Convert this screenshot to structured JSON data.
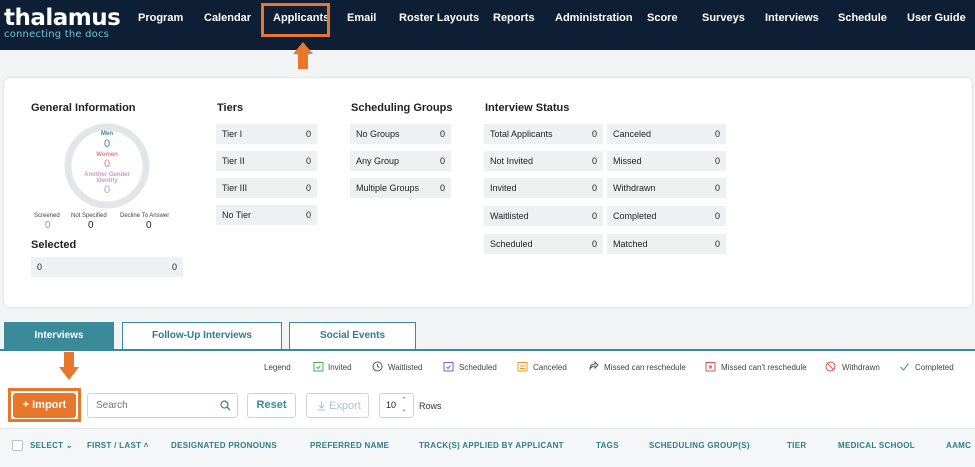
{
  "brand": {
    "name": "thalamus",
    "tagline": "connecting the docs"
  },
  "nav": {
    "items": [
      "Program",
      "Calendar",
      "Applicants",
      "Email",
      "Roster Layouts",
      "Reports",
      "Administration",
      "Score",
      "Surveys",
      "Interviews",
      "Schedule",
      "User Guide"
    ],
    "active": "Applicants"
  },
  "general_info": {
    "title": "General Information",
    "men_label": "Men",
    "men_value": "0",
    "women_label": "Women",
    "women_value": "0",
    "another_label_1": "Another Gender",
    "another_label_2": "Identity",
    "another_value": "0",
    "screened_label": "Screened",
    "screened_value": "0",
    "not_specified_label": "Not Specified",
    "not_specified_value": "0",
    "decline_label": "Decline To Answer",
    "decline_value": "0",
    "selected_title": "Selected",
    "selected_left": "0",
    "selected_right": "0"
  },
  "tiers": {
    "title": "Tiers",
    "rows": [
      {
        "label": "Tier I",
        "value": "0"
      },
      {
        "label": "Tier II",
        "value": "0"
      },
      {
        "label": "Tier III",
        "value": "0"
      },
      {
        "label": "No Tier",
        "value": "0"
      }
    ]
  },
  "scheduling_groups": {
    "title": "Scheduling Groups",
    "rows": [
      {
        "label": "No Groups",
        "value": "0"
      },
      {
        "label": "Any Group",
        "value": "0"
      },
      {
        "label": "Multiple Groups",
        "value": "0"
      }
    ]
  },
  "interview_status": {
    "title": "Interview Status",
    "left": [
      {
        "label": "Total Applicants",
        "value": "0"
      },
      {
        "label": "Not Invited",
        "value": "0"
      },
      {
        "label": "Invited",
        "value": "0"
      },
      {
        "label": "Waitlisted",
        "value": "0"
      },
      {
        "label": "Scheduled",
        "value": "0"
      }
    ],
    "right": [
      {
        "label": "Canceled",
        "value": "0"
      },
      {
        "label": "Missed",
        "value": "0"
      },
      {
        "label": "Withdrawn",
        "value": "0"
      },
      {
        "label": "Completed",
        "value": "0"
      },
      {
        "label": "Matched",
        "value": "0"
      }
    ]
  },
  "tabs": [
    "Interviews",
    "Follow-Up Interviews",
    "Social Events"
  ],
  "legend": {
    "title": "Legend",
    "items": [
      "Invited",
      "Waitlisted",
      "Scheduled",
      "Canceled",
      "Missed can reschedule",
      "Missed can't reschedule",
      "Withdrawn",
      "Completed"
    ]
  },
  "toolbar": {
    "import_label": "+ Import",
    "search_placeholder": "Search",
    "reset_label": "Reset",
    "export_label": "Export",
    "rows_value": "10",
    "rows_label": "Rows"
  },
  "table": {
    "headers": [
      "SELECT",
      "FIRST / LAST",
      "DESIGNATED PRONOUNS",
      "PREFERRED NAME",
      "TRACK(S) APPLIED BY APPLICANT",
      "TAGS",
      "SCHEDULING GROUP(S)",
      "TIER",
      "MEDICAL SCHOOL",
      "AAMC"
    ]
  },
  "colors": {
    "nav_bg": "#0e1f35",
    "accent": "#3a8a99",
    "highlight": "#e8762b"
  }
}
